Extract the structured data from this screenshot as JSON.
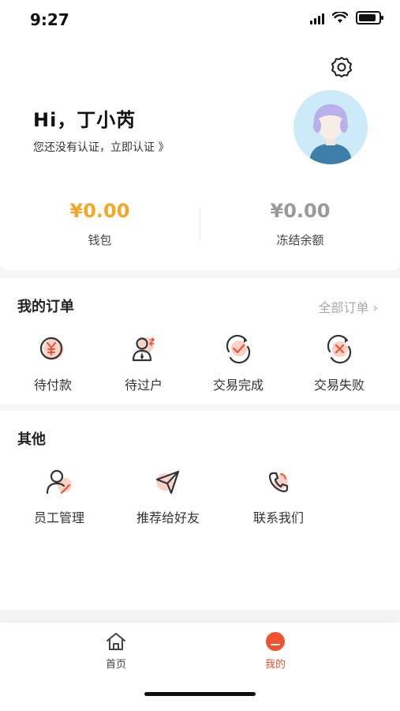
{
  "status_bar": {
    "time": "9:27"
  },
  "header": {
    "greeting": "Hi，丁小芮",
    "auth_prompt": "您还没有认证，立即认证 》",
    "wallet": {
      "amount": "¥0.00",
      "label": "钱包",
      "color": "#f5a623"
    },
    "frozen": {
      "amount": "¥0.00",
      "label": "冻结余额",
      "color": "#999999"
    }
  },
  "orders": {
    "title": "我的订单",
    "all_link": "全部订单 ›",
    "items": [
      {
        "label": "待付款",
        "icon": "yuan-payment-icon"
      },
      {
        "label": "待过户",
        "icon": "transfer-person-icon"
      },
      {
        "label": "交易完成",
        "icon": "check-complete-icon"
      },
      {
        "label": "交易失败",
        "icon": "x-failed-icon"
      }
    ]
  },
  "others": {
    "title": "其他",
    "items": [
      {
        "label": "员工管理",
        "icon": "staff-management-icon"
      },
      {
        "label": "推荐给好友",
        "icon": "paper-plane-icon"
      },
      {
        "label": "联系我们",
        "icon": "phone-icon"
      }
    ]
  },
  "tabbar": {
    "tabs": [
      {
        "label": "首页",
        "icon": "home-icon",
        "active": false
      },
      {
        "label": "我的",
        "icon": "profile-icon",
        "active": true
      }
    ],
    "accent": "#f0532f"
  }
}
